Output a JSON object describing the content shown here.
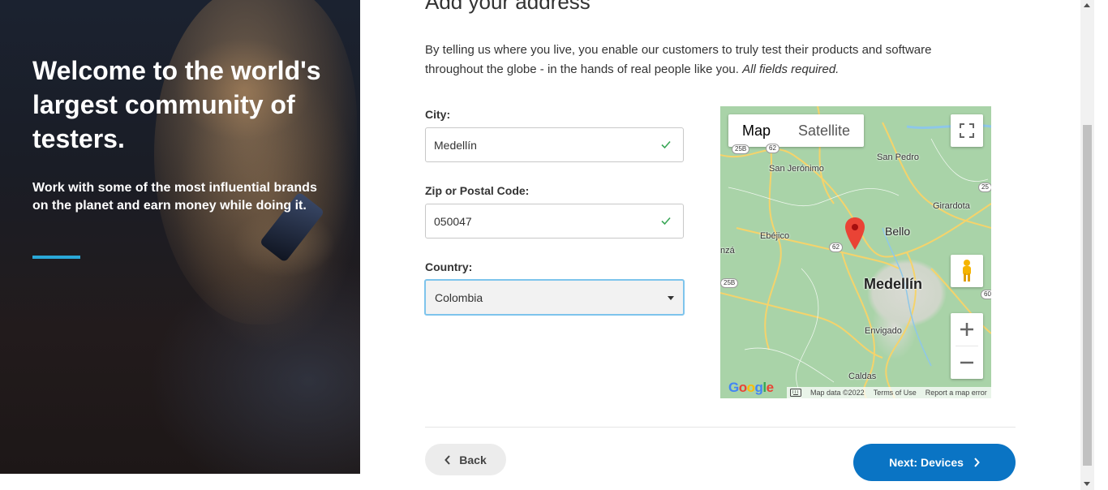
{
  "hero": {
    "title": "Welcome to the world's largest community of testers.",
    "subtitle": "Work with some of the most influential brands on the planet and earn money while doing it.",
    "accent_color": "#2aa8d8"
  },
  "form": {
    "heading": "Add your address",
    "intro": "By telling us where you live, you enable our customers to truly test their products and software throughout the globe - in the hands of real people like you.",
    "intro_note": "All fields required.",
    "city": {
      "label": "City:",
      "value": "Medellín",
      "valid": true
    },
    "zip": {
      "label": "Zip or Postal Code:",
      "value": "050047",
      "valid": true
    },
    "country": {
      "label": "Country:",
      "value": "Colombia"
    }
  },
  "map": {
    "map_tab": "Map",
    "satellite_tab": "Satellite",
    "towns": {
      "san_jeronimo": "San Jerónimo",
      "san_pedro": "San Pedro",
      "girardota": "Girardota",
      "bello": "Bello",
      "ebejico": "Ebéjico",
      "medellin": "Medellín",
      "envigado": "Envigado",
      "caldas": "Caldas",
      "anza": "nzá"
    },
    "shields": {
      "r25b_top": "25B",
      "r62_top": "62",
      "r25": "25",
      "r62_mid": "62",
      "r25b_left": "25B",
      "r60": "60"
    },
    "google_logo": "Google",
    "map_data": "Map data ©2022",
    "terms": "Terms of Use",
    "report": "Report a map error"
  },
  "nav": {
    "back_label": "Back",
    "next_label": "Next: Devices",
    "next_color": "#0a74c4"
  }
}
